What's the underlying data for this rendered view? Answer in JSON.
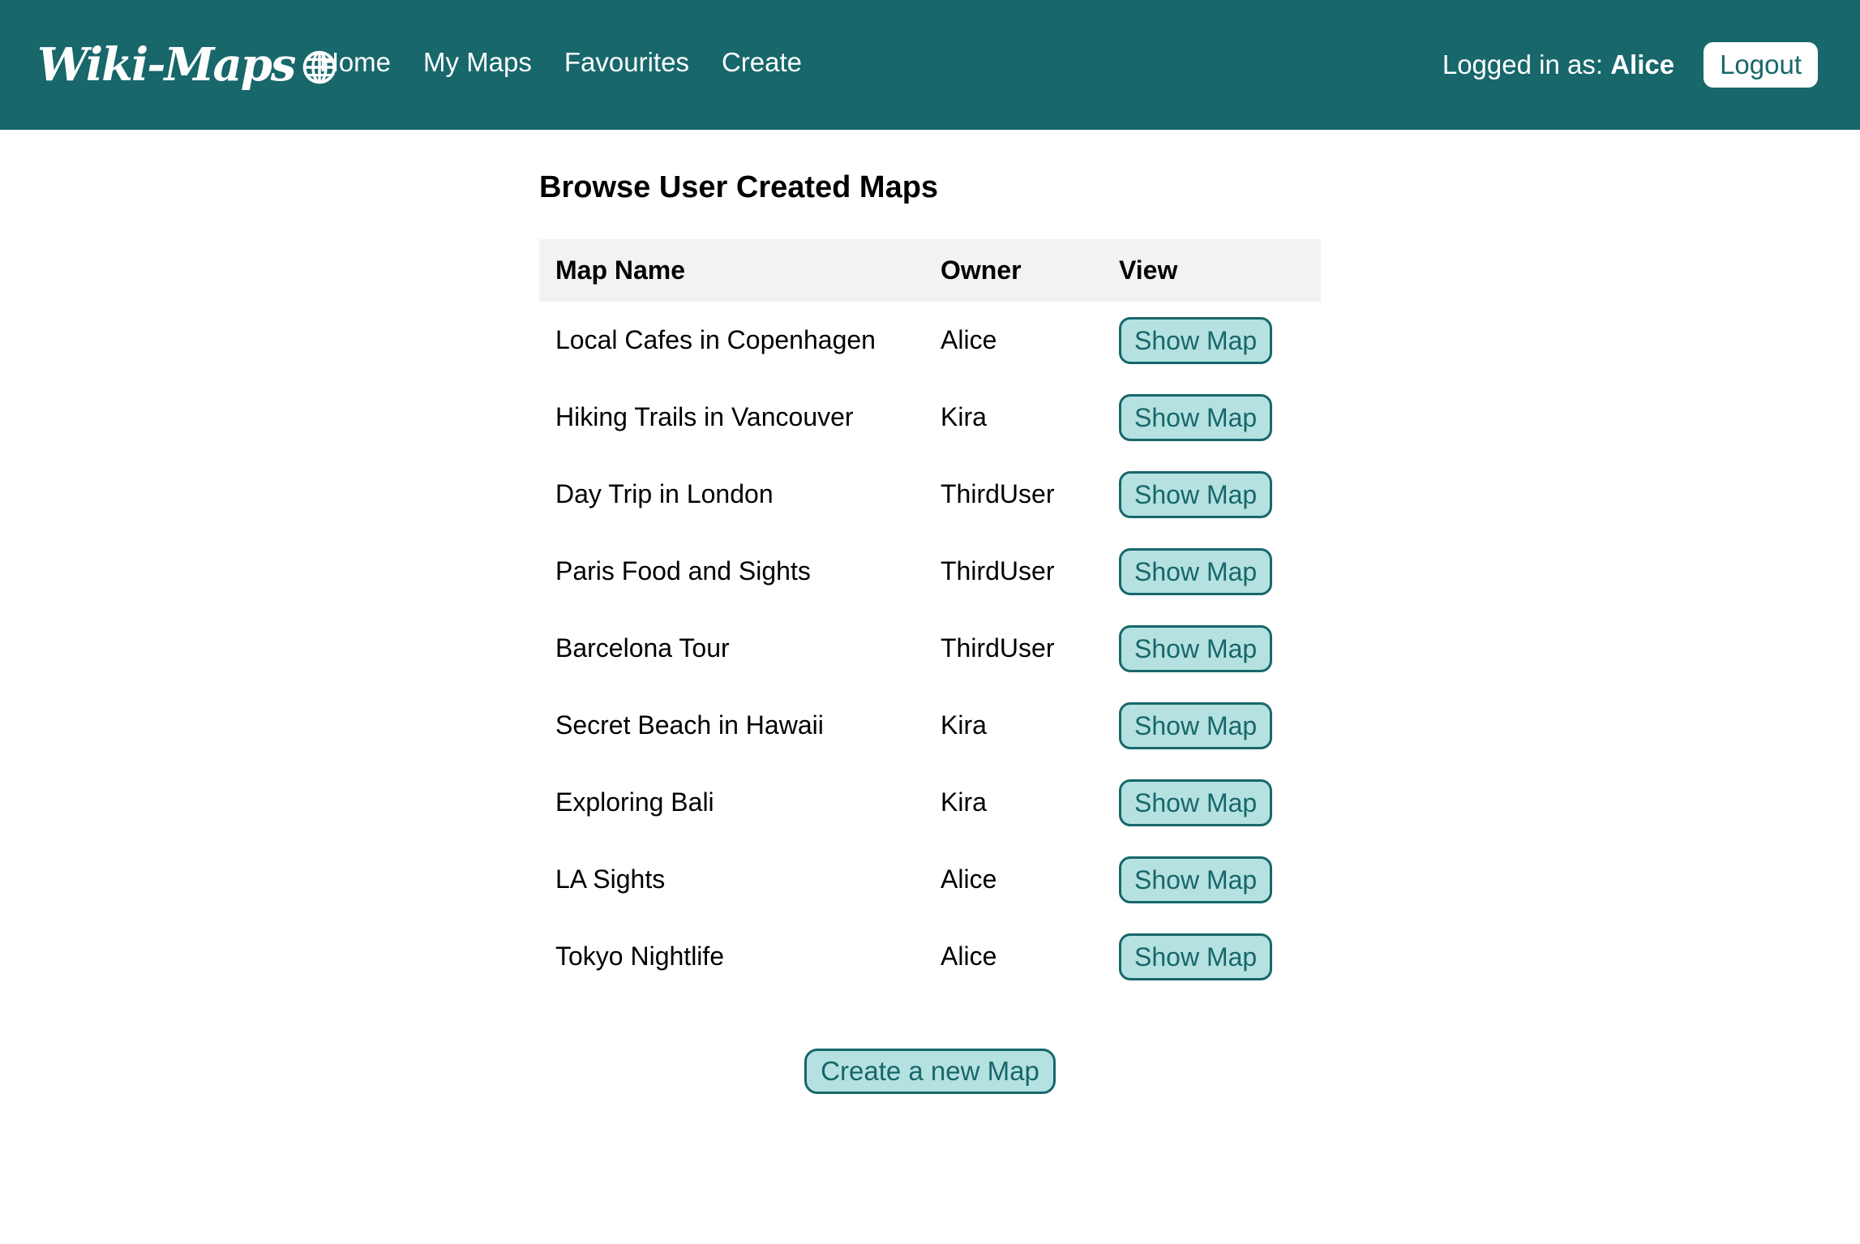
{
  "navbar": {
    "brand": "Wiki-Maps",
    "brand_icon": "globe-icon",
    "links": [
      "Home",
      "My Maps",
      "Favourites",
      "Create"
    ],
    "logged_in_prefix": "Logged in as:",
    "username": "Alice",
    "logout_label": "Logout"
  },
  "colors": {
    "navbar_bg": "#17676b",
    "button_bg": "#b5e1e1",
    "button_text": "#17676b",
    "table_header_bg": "#f2f2f2"
  },
  "main": {
    "title": "Browse User Created Maps",
    "columns": [
      "Map Name",
      "Owner",
      "View"
    ],
    "rows": [
      {
        "name": "Local Cafes in Copenhagen",
        "owner": "Alice",
        "action": "Show Map"
      },
      {
        "name": "Hiking Trails in Vancouver",
        "owner": "Kira",
        "action": "Show Map"
      },
      {
        "name": "Day Trip in London",
        "owner": "ThirdUser",
        "action": "Show Map"
      },
      {
        "name": "Paris Food and Sights",
        "owner": "ThirdUser",
        "action": "Show Map"
      },
      {
        "name": "Barcelona Tour",
        "owner": "ThirdUser",
        "action": "Show Map"
      },
      {
        "name": "Secret Beach in Hawaii",
        "owner": "Kira",
        "action": "Show Map"
      },
      {
        "name": "Exploring Bali",
        "owner": "Kira",
        "action": "Show Map"
      },
      {
        "name": "LA Sights",
        "owner": "Alice",
        "action": "Show Map"
      },
      {
        "name": "Tokyo Nightlife",
        "owner": "Alice",
        "action": "Show Map"
      }
    ],
    "create_label": "Create a new Map"
  }
}
